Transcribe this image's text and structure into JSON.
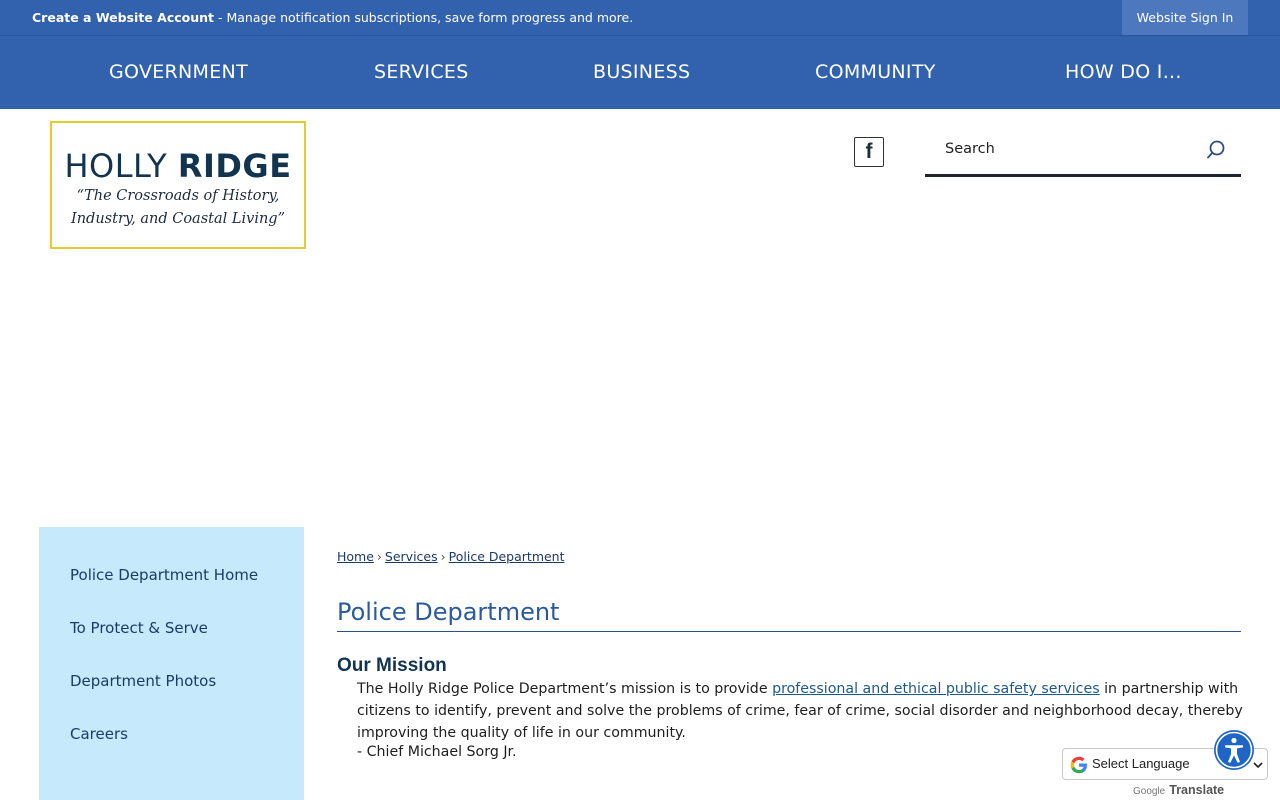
{
  "topbar": {
    "create_account_link": "Create a Website Account",
    "create_account_desc": " - Manage notification subscriptions, save form progress and more.",
    "signin_label": "Website Sign In"
  },
  "nav": {
    "items": [
      "GOVERNMENT",
      "SERVICES",
      "BUSINESS",
      "COMMUNITY",
      "HOW DO I..."
    ]
  },
  "logo": {
    "name_light": "HOLLY ",
    "name_bold": "RIDGE",
    "tagline_line1": "“The Crossroads of History,",
    "tagline_line2": "Industry, and Coastal Living”"
  },
  "social": {
    "facebook_glyph": "f"
  },
  "search": {
    "placeholder": "Search"
  },
  "sidebar": {
    "items": [
      "Police Department Home",
      "To Protect & Serve",
      "Department Photos",
      "Careers"
    ]
  },
  "breadcrumb": {
    "items": [
      "Home",
      "Services",
      "Police Department"
    ],
    "separator": "›"
  },
  "page": {
    "title": "Police Department",
    "section_heading": "Our Mission",
    "mission_before_link": "The Holly Ridge Police Department’s mission is to provide ",
    "mission_link": "professional and ethical public safety services",
    "mission_after_link": " in partnership with citizens to identify, prevent and solve the problems of crime, fear of crime, social disorder and neighborhood decay, thereby improving the quality of life in our community.",
    "signature": "- Chief Michael Sorg Jr."
  },
  "translate": {
    "select_label": "Select Language",
    "powered_by_brand": "Google",
    "powered_by_word": "Translate"
  },
  "colors": {
    "nav_blue": "#3261ae",
    "sidebar_bg": "#c6eafb",
    "logo_border": "#e2cd2b",
    "title_blue": "#2b5b9c"
  },
  "icons": {
    "search": "search-icon",
    "facebook": "facebook-icon",
    "google": "google-g-icon",
    "accessibility": "accessibility-icon"
  }
}
